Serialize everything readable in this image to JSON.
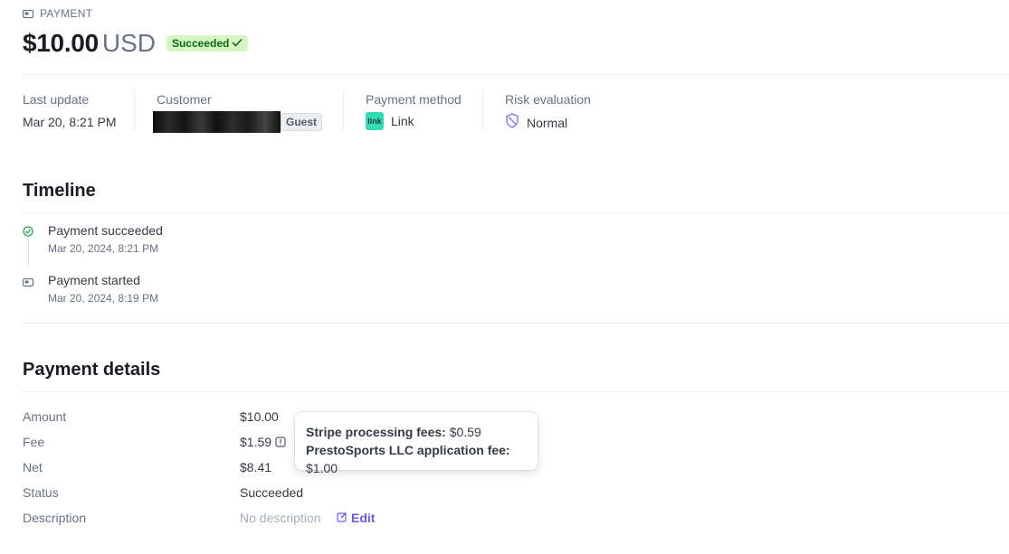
{
  "header": {
    "kicker": "PAYMENT",
    "amount": "$10.00",
    "currency": "USD",
    "status_badge": "Succeeded"
  },
  "summary": {
    "last_update_label": "Last update",
    "last_update_value": "Mar 20, 8:21 PM",
    "customer_label": "Customer",
    "customer_tag": "Guest",
    "payment_method_label": "Payment method",
    "payment_method_value": "Link",
    "payment_method_icon_text": "link",
    "risk_label": "Risk evaluation",
    "risk_value": "Normal"
  },
  "timeline": {
    "title": "Timeline",
    "events": [
      {
        "title": "Payment succeeded",
        "time": "Mar 20, 2024, 8:21 PM",
        "icon": "check-circle-icon"
      },
      {
        "title": "Payment started",
        "time": "Mar 20, 2024, 8:19 PM",
        "icon": "card-icon"
      }
    ]
  },
  "payment_details": {
    "title": "Payment details",
    "rows": [
      {
        "label": "Amount",
        "value": "$10.00"
      },
      {
        "label": "Fee",
        "value": "$1.59"
      },
      {
        "label": "Net",
        "value": "$8.41"
      },
      {
        "label": "Status",
        "value": "Succeeded"
      },
      {
        "label": "Description",
        "value": "No description"
      }
    ],
    "edit_label": "Edit"
  },
  "fee_tooltip": {
    "stripe_label": "Stripe processing fees:",
    "stripe_value": "$0.59",
    "app_label": "PrestoSports LLC application fee:",
    "app_value": "$1.00"
  },
  "colors": {
    "success_bg": "#d7f7c2",
    "success_text": "#05690d",
    "accent": "#635bff",
    "link_green": "#33ddb3"
  }
}
